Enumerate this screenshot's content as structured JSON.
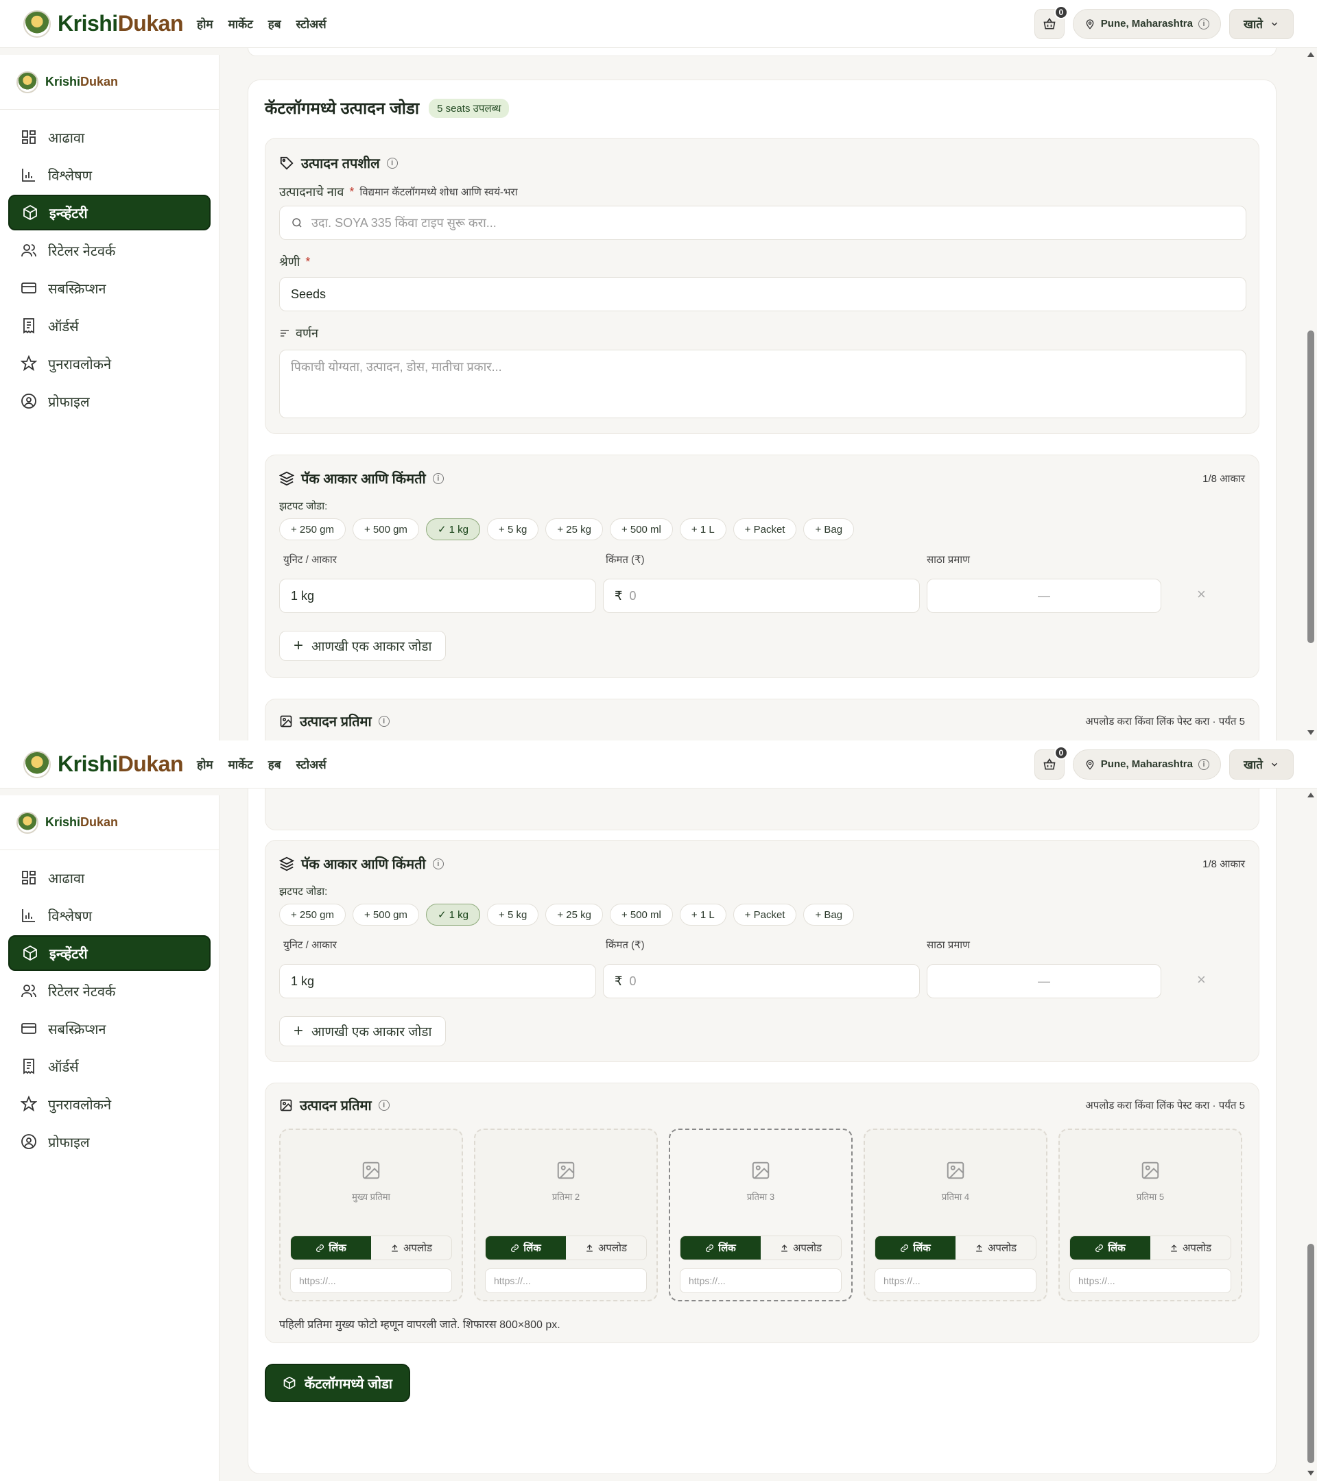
{
  "brand": {
    "part1": "Krishi",
    "part2": "Dukan"
  },
  "topnav": [
    "होम",
    "मार्केट",
    "हब",
    "स्टोअर्स"
  ],
  "cart": {
    "count": "0"
  },
  "location": "Pune, Maharashtra",
  "account": "खाते",
  "sidebar": {
    "items": [
      {
        "label": "आढावा",
        "icon": "grid-icon"
      },
      {
        "label": "विश्लेषण",
        "icon": "bar-chart-icon"
      },
      {
        "label": "इन्व्हेंटरी",
        "icon": "box-icon",
        "active": true
      },
      {
        "label": "रिटेलर नेटवर्क",
        "icon": "users-icon"
      },
      {
        "label": "सबस्क्रिप्शन",
        "icon": "card-icon"
      },
      {
        "label": "ऑर्डर्स",
        "icon": "receipt-icon"
      },
      {
        "label": "पुनरावलोकने",
        "icon": "star-icon"
      },
      {
        "label": "प्रोफाइल",
        "icon": "user-circle-icon"
      }
    ]
  },
  "form": {
    "title": "कॅटलॉगमध्ये उत्पादन जोडा",
    "seats_badge": "5 seats उपलब्ध",
    "details": {
      "title": "उत्पादन तपशील",
      "name_label": "उत्पादनाचे नाव",
      "name_hint": "विद्यमान कॅटलॉगमध्ये शोधा आणि स्वयं-भरा",
      "name_placeholder": "उदा. SOYA 335 किंवा टाइप सुरू करा...",
      "category_label": "श्रेणी",
      "category_value": "Seeds",
      "desc_label": "वर्णन",
      "desc_placeholder": "पिकाची योग्यता, उत्पादन, डोस, मातीचा प्रकार..."
    },
    "pack": {
      "title": "पॅक आकार आणि किंमती",
      "count_note": "1/8 आकार",
      "quick_label": "झटपट जोडा:",
      "chips": [
        "+ 250 gm",
        "+ 500 gm",
        "✓ 1 kg",
        "+ 5 kg",
        "+ 25 kg",
        "+ 500 ml",
        "+ 1 L",
        "+ Packet",
        "+ Bag"
      ],
      "selected_chip": 2,
      "col_unit": "युनिट / आकार",
      "col_price": "किंमत (₹)",
      "col_stock": "साठा प्रमाण",
      "row_unit": "1 kg",
      "rupee": "₹",
      "price_placeholder": "0",
      "stock_placeholder": "—",
      "add_label": "आणखी एक आकार जोडा"
    },
    "images": {
      "title": "उत्पादन प्रतिमा",
      "right_note": "अपलोड करा किंवा लिंक पेस्ट करा · पर्यंत 5",
      "slots": [
        "मुख्य प्रतिमा",
        "प्रतिमा 2",
        "प्रतिमा 3",
        "प्रतिमा 4",
        "प्रतिमा 5"
      ],
      "link_label": "लिंक",
      "upload_label": "अपलोड",
      "url_placeholder": "https://...",
      "footnote": "पहिली प्रतिमा मुख्य फोटो म्हणून वापरली जाते. शिफारस 800×800 px."
    },
    "submit_label": "कॅटलॉगमध्ये जोडा"
  },
  "colors": {
    "primary": "#184318",
    "brand_green": "#174a17",
    "brand_brown": "#7a4a1d"
  }
}
